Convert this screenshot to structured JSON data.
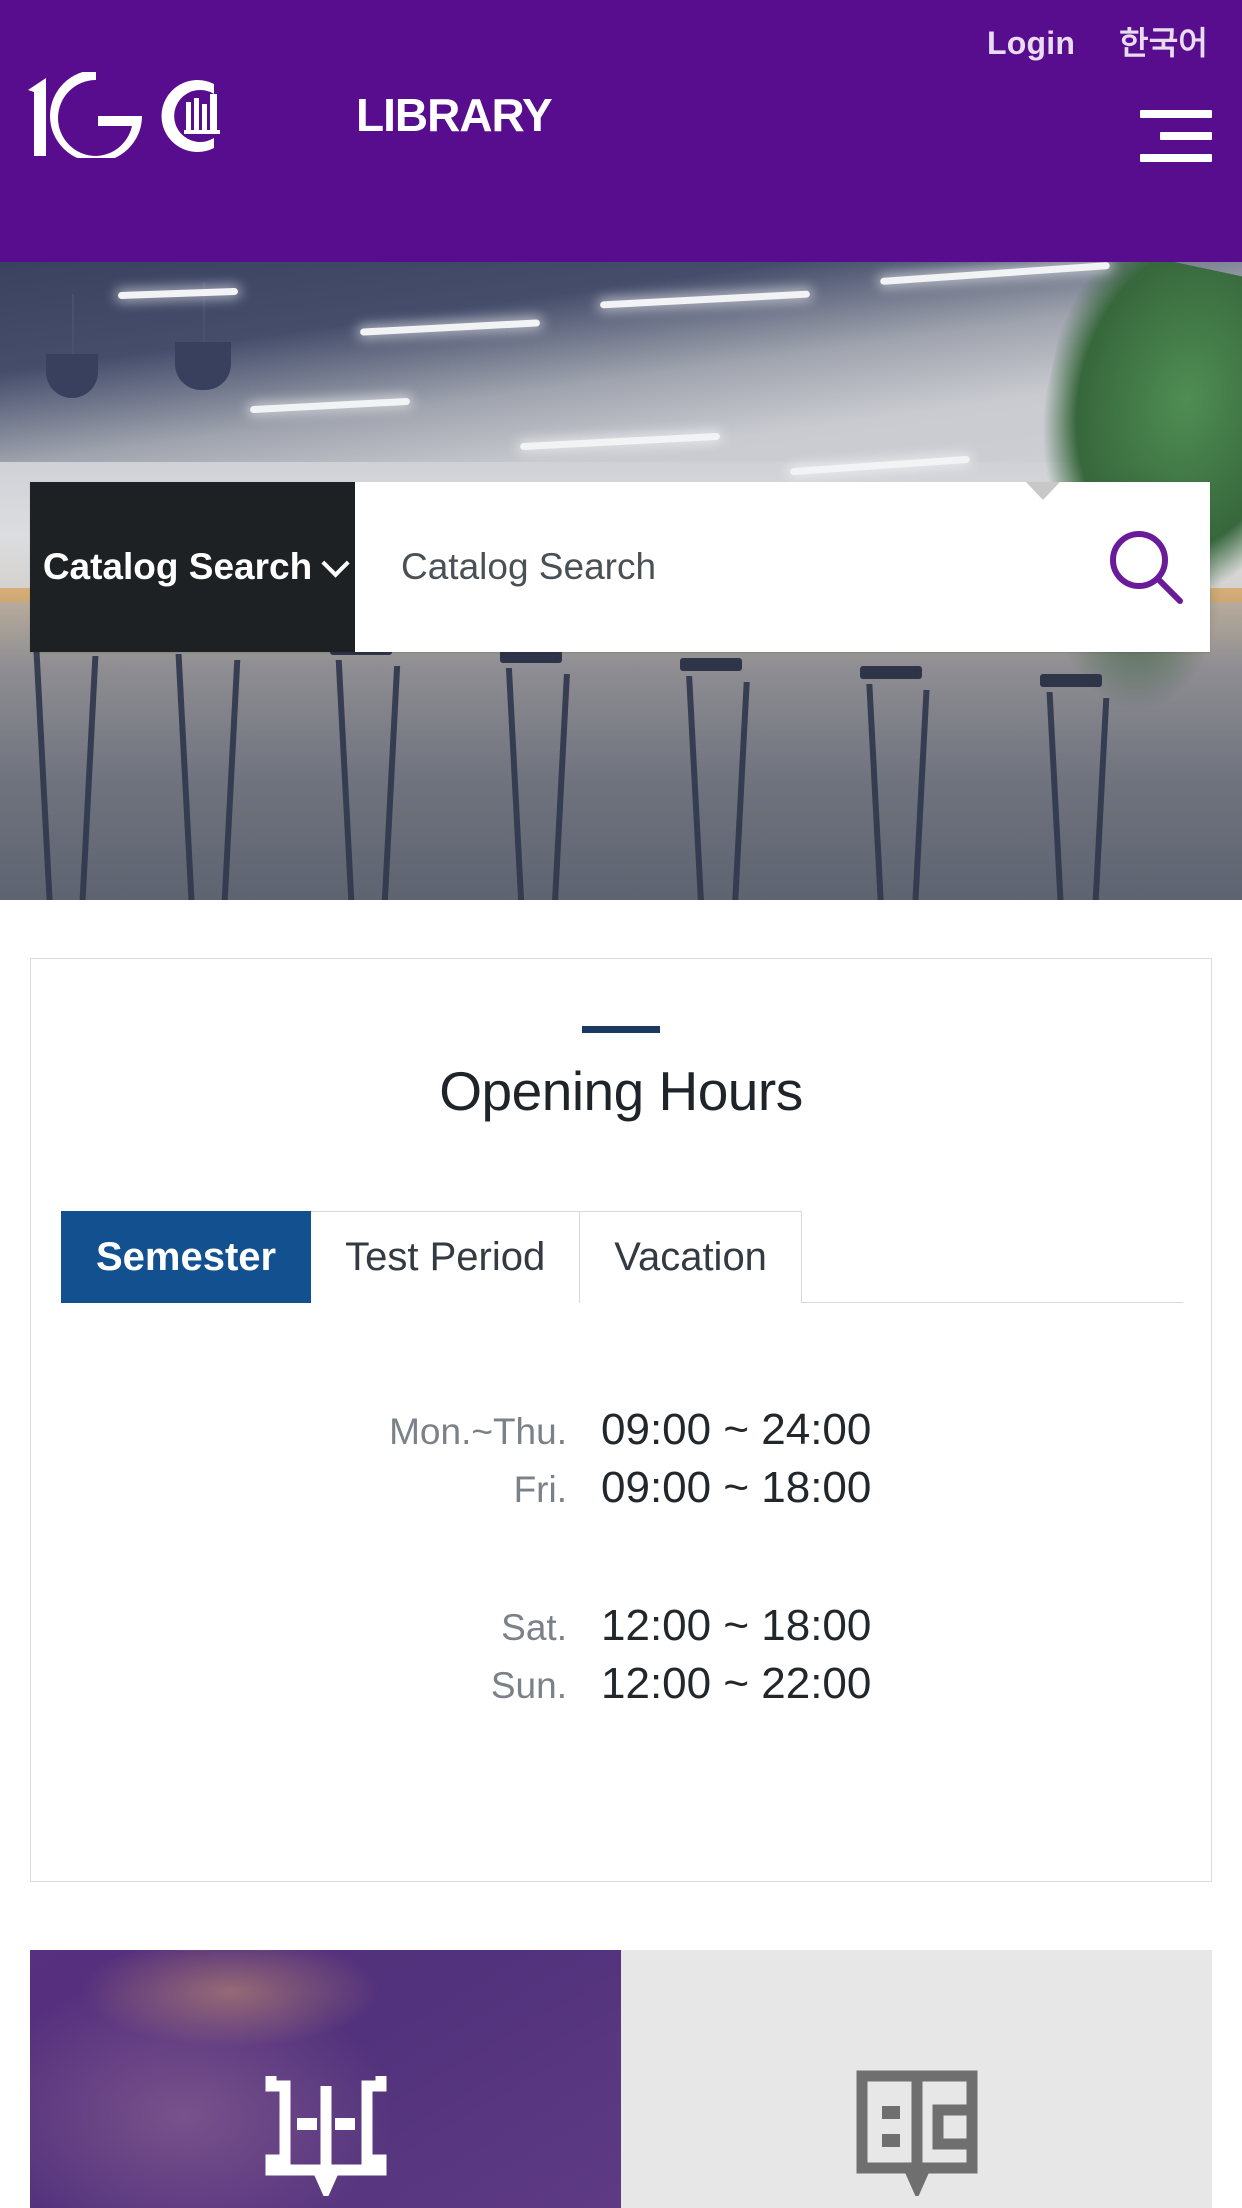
{
  "colors": {
    "header_purple": "#580C8E",
    "accent_blue": "#13508F",
    "title_rule": "#1b3860",
    "select_dark": "#1d2124",
    "tile_purple": "#57307E",
    "tile_gray": "#E7E7E7",
    "search_icon": "#6A1B9A"
  },
  "header": {
    "login_label": "Login",
    "language_label": "한국어",
    "logo_text": "1GC",
    "logo_suffix": "LIBRARY",
    "menu_icon": "hamburger-icon"
  },
  "search": {
    "category_label": "Catalog Search",
    "placeholder": "Catalog Search",
    "value": "",
    "dropdown_icon": "chevron-down-icon",
    "caret_icon": "caret-down-icon",
    "submit_icon": "search-icon"
  },
  "opening_hours": {
    "title": "Opening Hours",
    "tabs": [
      {
        "label": "Semester",
        "active": true
      },
      {
        "label": "Test Period",
        "active": false
      },
      {
        "label": "Vacation",
        "active": false
      }
    ],
    "rows": [
      {
        "day": "Mon.~Thu.",
        "time": "09:00 ~ 24:00"
      },
      {
        "day": "Fri.",
        "time": "09:00 ~ 18:00"
      },
      {
        "day": "Sat.",
        "time": "12:00 ~ 18:00"
      },
      {
        "day": "Sun.",
        "time": "12:00 ~ 22:00"
      }
    ]
  },
  "tiles": [
    {
      "icon": "open-book-icon",
      "active": true
    },
    {
      "icon": "book-reading-icon",
      "active": false
    }
  ]
}
